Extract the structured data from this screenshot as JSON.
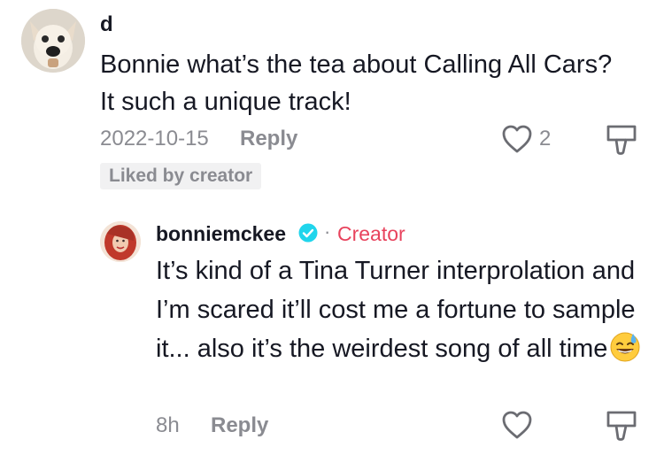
{
  "comment": {
    "username": "d",
    "text": "Bonnie what’s the tea about Calling All Cars? It such a unique track!",
    "date": "2022-10-15",
    "reply_label": "Reply",
    "like_count": "2",
    "liked_by_creator": "Liked by creator",
    "avatar_icon": "chihuahua-avatar"
  },
  "reply": {
    "username": "bonniemckee",
    "separator": "·",
    "creator_label": "Creator",
    "text": "It’s kind of a Tina Turner interprolation and I’m scared it’ll cost me a fortune to sample it... also it’s the weirdest song of all time",
    "emoji": "😅",
    "time": "8h",
    "reply_label": "Reply",
    "avatar_icon": "red-hair-woman-avatar"
  },
  "colors": {
    "text": "#161823",
    "muted": "#8a8b91",
    "creator": "#e8435d",
    "verified": "#20d5ec",
    "badge_bg": "#f1f1f2"
  },
  "icons": [
    "heart-icon",
    "dislike-icon",
    "verified-icon"
  ]
}
